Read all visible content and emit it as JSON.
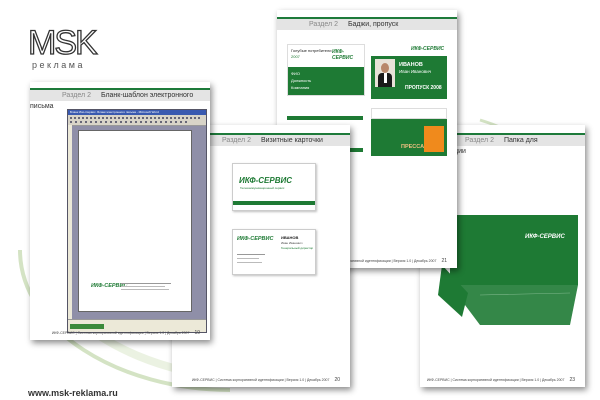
{
  "brand": {
    "logo_text": "MSK",
    "logo_sub": "реклама",
    "website": "www.msk-reklama.ru"
  },
  "colors": {
    "accent": "#1e7a34",
    "orange": "#f08a1c"
  },
  "pages": {
    "letter": {
      "section": "Раздел 2",
      "title": "Бланк-шаблон электронного письма",
      "window_title": "Бланк Ико-Сервис. Бланк электронного письма - Microsoft Word",
      "footer": "ИКФ-СЕРВИС  |  Система корпоративной идентификации  |  Версия 1.0  |  Декабрь 2007",
      "page_number": "19",
      "company": "ИКФ-СЕРВИС"
    },
    "badge": {
      "section": "Раздел 2",
      "title": "Баджи, пропуск",
      "event_label": "Голубые потребители",
      "event_date": "2007",
      "fio": "ФИО",
      "position": "Должность",
      "company_label": "Компания",
      "name": "ИВАНОВ",
      "patronymic": "Иван Иванович",
      "pass_label": "ПРОПУСК 2008",
      "press": "ПРЕССА",
      "footer": "ИКФ-СЕРВИС  |  Система корпоративной идентификации  |  Версия 1.0  |  Декабрь 2007",
      "page_number": "21",
      "company": "ИКФ-СЕРВИС"
    },
    "cards": {
      "section": "Раздел 2",
      "title": "Визитные карточки",
      "card_tagline": "Телекоммуникационный сервис",
      "card_name": "ИВАНОВ",
      "card_patronymic": "Иван Иванович",
      "card_position": "Генеральный директор",
      "footer": "ИКФ-СЕРВИС  |  Система корпоративной идентификации  |  Версия 1.0  |  Декабрь 2007",
      "page_number": "20",
      "company": "ИКФ-СЕРВИС"
    },
    "folder": {
      "section": "Раздел 2",
      "title": "Папка для документации",
      "footer": "ИКФ-СЕРВИС  |  Система корпоративной идентификации  |  Версия 1.0  |  Декабрь 2007",
      "page_number": "23",
      "company": "ИКФ-СЕРВИС"
    }
  }
}
